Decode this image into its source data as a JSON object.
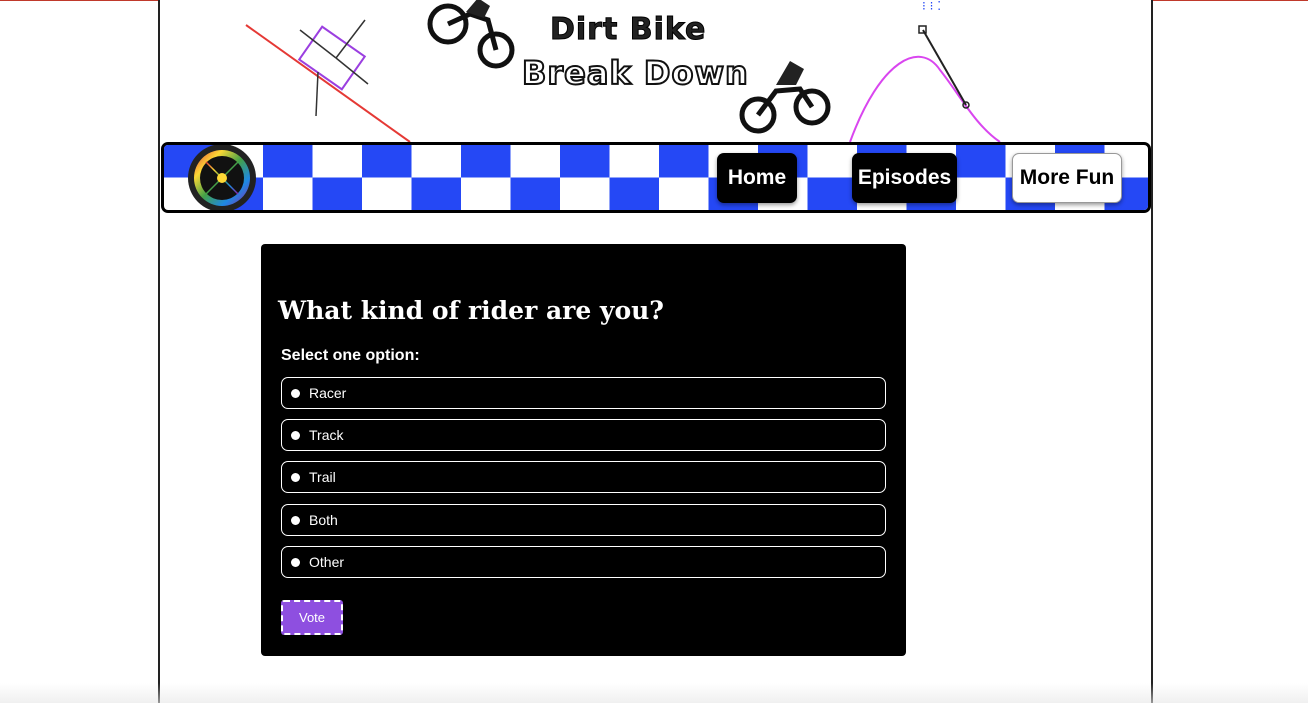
{
  "site": {
    "title_line1": "Dirt Bike",
    "title_line2": "Break Down"
  },
  "nav": {
    "items": [
      {
        "label": "Home"
      },
      {
        "label": "Episodes"
      },
      {
        "label": "More Fun"
      }
    ],
    "logo_icon": "wheel-logo-icon"
  },
  "poll": {
    "heading": "What kind of rider are you?",
    "prompt": "Select one option:",
    "options": [
      {
        "label": "Racer"
      },
      {
        "label": "Track"
      },
      {
        "label": "Trail"
      },
      {
        "label": "Both"
      },
      {
        "label": "Other"
      }
    ],
    "vote_label": "Vote"
  },
  "colors": {
    "checker_blue": "#2548f5",
    "vote_purple": "#8e4fe0",
    "curve_magenta": "#d946ef",
    "incline_red": "#e53935"
  }
}
